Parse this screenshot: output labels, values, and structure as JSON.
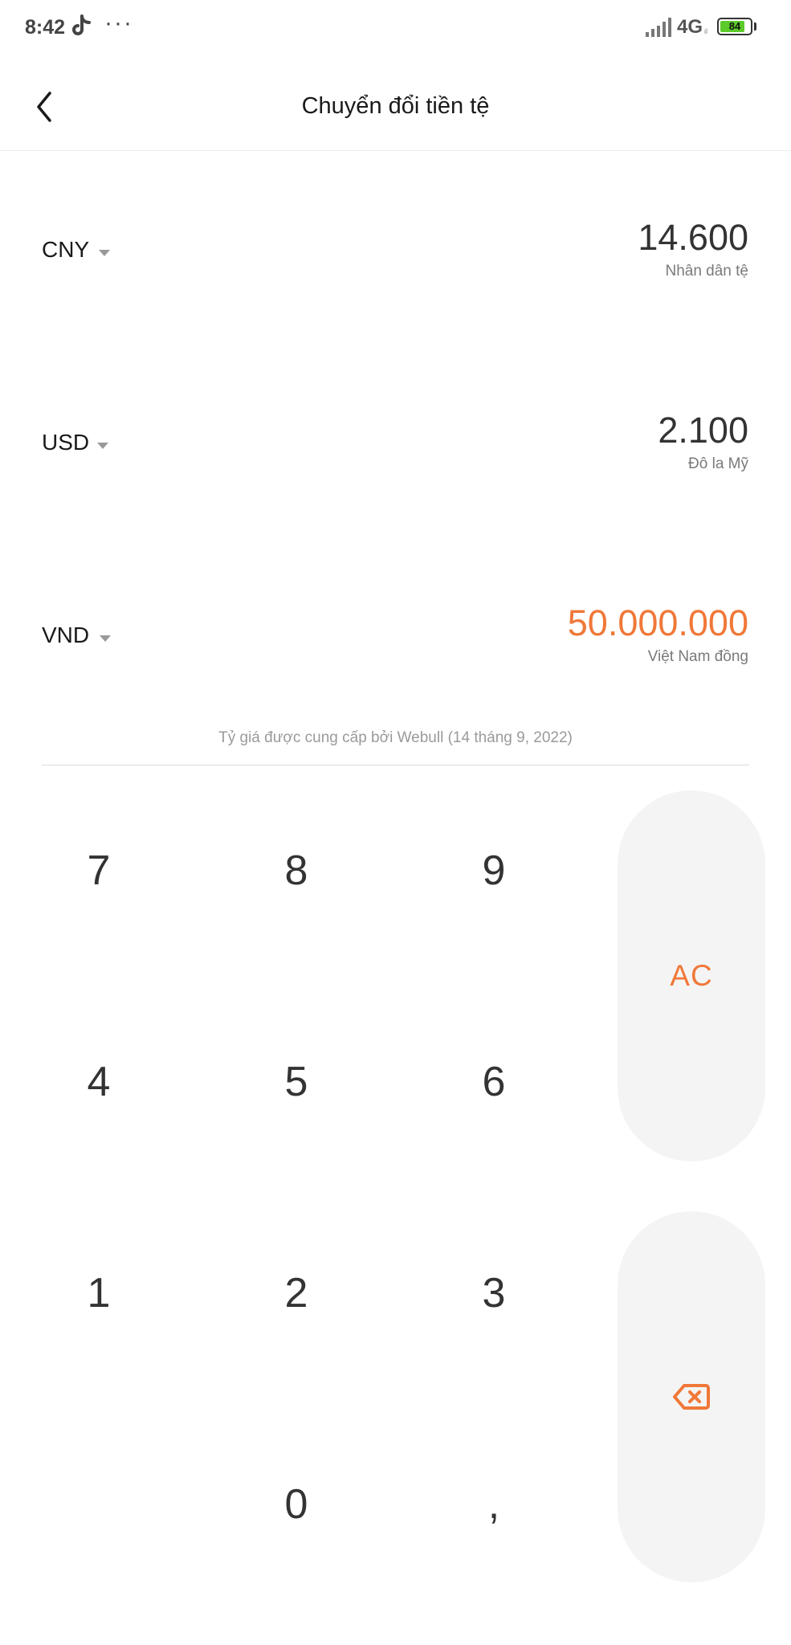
{
  "status": {
    "time": "8:42",
    "more": "···",
    "network": "4G",
    "network_sub": "il",
    "battery": "84",
    "battery_level": 0.84
  },
  "header": {
    "title": "Chuyển đổi tiền tệ"
  },
  "currencies": [
    {
      "code": "CNY",
      "amount": "14.600",
      "name": "Nhân dân tệ",
      "active": false
    },
    {
      "code": "USD",
      "amount": "2.100",
      "name": "Đô la Mỹ",
      "active": false
    },
    {
      "code": "VND",
      "amount": "50.000.000",
      "name": "Việt Nam đồng",
      "active": true
    }
  ],
  "rate_note": "Tỷ giá được cung cấp bởi Webull (14 tháng 9, 2022)",
  "keypad": {
    "keys": [
      "7",
      "8",
      "9",
      "4",
      "5",
      "6",
      "1",
      "2",
      "3",
      "0",
      ","
    ],
    "clear_label": "AC"
  },
  "colors": {
    "accent": "#f07838",
    "pill_bg": "#f4f4f4",
    "battery": "#5ccb2a"
  }
}
